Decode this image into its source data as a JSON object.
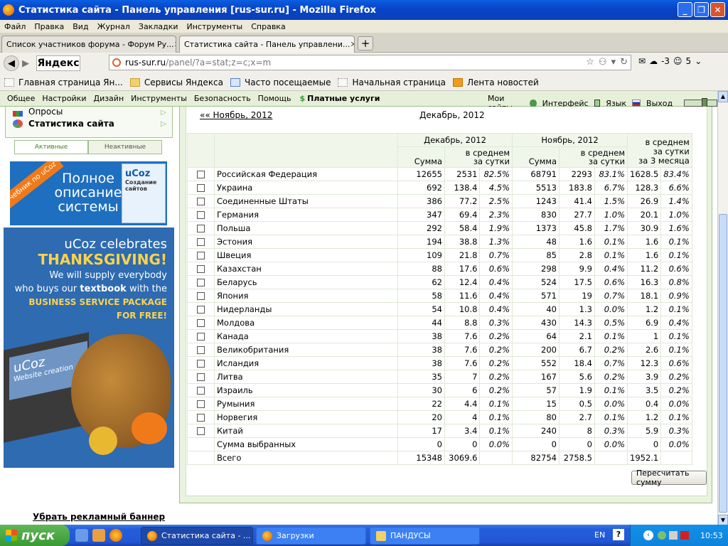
{
  "window": {
    "title": "Статистика сайта - Панель управления [rus-sur.ru] - Mozilla Firefox",
    "btn_min": "_",
    "btn_max": "❐",
    "btn_close": "✕"
  },
  "menu": [
    "Файл",
    "Правка",
    "Вид",
    "Журнал",
    "Закладки",
    "Инструменты",
    "Справка"
  ],
  "tabs": [
    {
      "label": "Список участников форума - Форум Ру...",
      "close": "✕"
    },
    {
      "label": "Статистика сайта - Панель управлени...",
      "close": "✕"
    }
  ],
  "tab_new": "+",
  "nav": {
    "yandex": "Яндекс",
    "url_host": "rus-sur.ru",
    "url_path": "/panel/?a=stat;z=c;x=m",
    "cloud_count": "-3",
    "notif_count": "5"
  },
  "bookmarks": [
    "Главная страница Ян...",
    "Сервисы Яндекса",
    "Часто посещаемые",
    "Начальная страница",
    "Лента новостей"
  ],
  "sitebar": {
    "items": [
      "Общее",
      "Настройки",
      "Дизайн",
      "Инструменты",
      "Безопасность",
      "Помощь"
    ],
    "paid": "Платные услуги",
    "my_sites": "Мои сайты",
    "interface": "Интерфейс",
    "language": "Язык",
    "logout": "Выход"
  },
  "left": {
    "items": [
      "Опросы",
      "Статистика сайта"
    ],
    "seg_active": "Активные",
    "seg_inactive": "Неактивные",
    "banner1": {
      "ribbon": "Учебник по uCoz",
      "text": "Полное описание системы",
      "box": "uCoz",
      "box_sub": "Создание сайтов"
    },
    "banner2": {
      "l1": "uCoz celebrates",
      "l2": "THANKSGIVING!",
      "l3a": "We will supply everybody",
      "l3b_pre": "who buys our ",
      "l3b_bold": "textbook",
      "l3b_post": " with the",
      "l4a": "BUSINESS SERVICE PACKAGE",
      "l4b": "FOR FREE!",
      "screen": "uCoz",
      "screen_sub": "Website creation"
    },
    "remove_banner": "Убрать рекламный баннер"
  },
  "stats": {
    "prev_month": "«« Ноябрь, 2012",
    "current_month": "Декабрь, 2012",
    "col_dec": "Декабрь, 2012",
    "col_nov": "Ноябрь, 2012",
    "col_avg3_a": "в среднем",
    "col_avg3_b": "за сутки",
    "col_avg3_c": "за 3 месяца",
    "sum": "Сумма",
    "avg_a": "в среднем",
    "avg_b": "за сутки",
    "rows": [
      [
        "Российская Федерация",
        "12655",
        "2531",
        "82.5%",
        "68791",
        "2293",
        "83.1%",
        "1628.5",
        "83.4%"
      ],
      [
        "Украина",
        "692",
        "138.4",
        "4.5%",
        "5513",
        "183.8",
        "6.7%",
        "128.3",
        "6.6%"
      ],
      [
        "Соединенные Штаты",
        "386",
        "77.2",
        "2.5%",
        "1243",
        "41.4",
        "1.5%",
        "26.9",
        "1.4%"
      ],
      [
        "Германия",
        "347",
        "69.4",
        "2.3%",
        "830",
        "27.7",
        "1.0%",
        "20.1",
        "1.0%"
      ],
      [
        "Польша",
        "292",
        "58.4",
        "1.9%",
        "1373",
        "45.8",
        "1.7%",
        "30.9",
        "1.6%"
      ],
      [
        "Эстония",
        "194",
        "38.8",
        "1.3%",
        "48",
        "1.6",
        "0.1%",
        "1.6",
        "0.1%"
      ],
      [
        "Швеция",
        "109",
        "21.8",
        "0.7%",
        "85",
        "2.8",
        "0.1%",
        "1.6",
        "0.1%"
      ],
      [
        "Казахстан",
        "88",
        "17.6",
        "0.6%",
        "298",
        "9.9",
        "0.4%",
        "11.2",
        "0.6%"
      ],
      [
        "Беларусь",
        "62",
        "12.4",
        "0.4%",
        "524",
        "17.5",
        "0.6%",
        "16.3",
        "0.8%"
      ],
      [
        "Япония",
        "58",
        "11.6",
        "0.4%",
        "571",
        "19",
        "0.7%",
        "18.1",
        "0.9%"
      ],
      [
        "Нидерланды",
        "54",
        "10.8",
        "0.4%",
        "40",
        "1.3",
        "0.0%",
        "1.2",
        "0.1%"
      ],
      [
        "Молдова",
        "44",
        "8.8",
        "0.3%",
        "430",
        "14.3",
        "0.5%",
        "6.9",
        "0.4%"
      ],
      [
        "Канада",
        "38",
        "7.6",
        "0.2%",
        "64",
        "2.1",
        "0.1%",
        "1",
        "0.1%"
      ],
      [
        "Великобритания",
        "38",
        "7.6",
        "0.2%",
        "200",
        "6.7",
        "0.2%",
        "2.6",
        "0.1%"
      ],
      [
        "Исландия",
        "38",
        "7.6",
        "0.2%",
        "552",
        "18.4",
        "0.7%",
        "12.3",
        "0.6%"
      ],
      [
        "Литва",
        "35",
        "7",
        "0.2%",
        "167",
        "5.6",
        "0.2%",
        "3.9",
        "0.2%"
      ],
      [
        "Израиль",
        "30",
        "6",
        "0.2%",
        "57",
        "1.9",
        "0.1%",
        "3.5",
        "0.2%"
      ],
      [
        "Румыния",
        "22",
        "4.4",
        "0.1%",
        "15",
        "0.5",
        "0.0%",
        "0.4",
        "0.0%"
      ],
      [
        "Норвегия",
        "20",
        "4",
        "0.1%",
        "80",
        "2.7",
        "0.1%",
        "1.2",
        "0.1%"
      ],
      [
        "Китай",
        "17",
        "3.4",
        "0.1%",
        "240",
        "8",
        "0.3%",
        "5.9",
        "0.3%"
      ]
    ],
    "selected_sum": [
      "Сумма выбранных",
      "0",
      "0",
      "0.0%",
      "0",
      "0",
      "0.0%",
      "0",
      "0.0%"
    ],
    "total": [
      "Всего",
      "15348",
      "3069.6",
      "",
      "82754",
      "2758.5",
      "",
      "1952.1",
      ""
    ],
    "recalc": "Пересчитать сумму"
  },
  "taskbar": {
    "start": "пуск",
    "tasks": [
      "Статистика сайта - ...",
      "Загрузки",
      "ПАНДУСЫ"
    ],
    "lang": "EN",
    "help": "?",
    "time": "10:53"
  }
}
